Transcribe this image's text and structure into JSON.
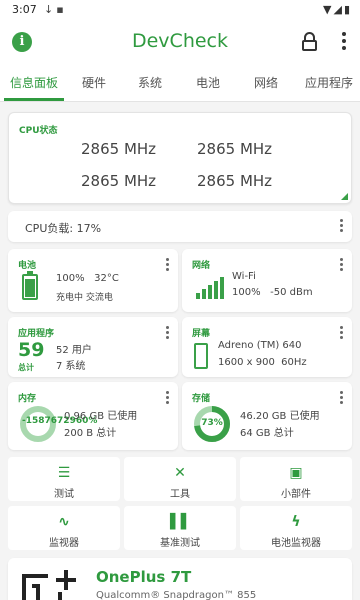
{
  "status_bar": {
    "time": "3:07",
    "icons_left": [
      "download-icon",
      "sim-icon"
    ],
    "icons_right": [
      "wifi-icon",
      "signal-icon",
      "battery-icon"
    ]
  },
  "app_bar": {
    "title": "DevCheck",
    "info_icon": "info-icon",
    "lock_icon": "lock-icon",
    "more_icon": "more-vert-icon"
  },
  "tabs": [
    {
      "label": "信息面板",
      "active": true
    },
    {
      "label": "硬件",
      "active": false
    },
    {
      "label": "系统",
      "active": false
    },
    {
      "label": "电池",
      "active": false
    },
    {
      "label": "网络",
      "active": false
    },
    {
      "label": "应用程序",
      "active": false
    }
  ],
  "cpu": {
    "title": "CPU状态",
    "freqs": [
      "2865 MHz",
      "2865 MHz",
      "2865 MHz",
      "2865 MHz"
    ]
  },
  "cpu_load": "CPU负载: 17%",
  "battery": {
    "title": "电池",
    "level": "100%",
    "temp": "32°C",
    "status": "充电中 交流电",
    "fill": 1.0
  },
  "network": {
    "title": "网络",
    "type": "Wi-Fi",
    "quality": "100%",
    "dbm": "-50 dBm",
    "signal_bars": 5
  },
  "apps": {
    "title": "应用程序",
    "total": "59",
    "total_label": "总计",
    "user": "52 用户",
    "system": "7 系统"
  },
  "screen": {
    "title": "屏幕",
    "gpu": "Adreno (TM) 640",
    "resolution": "1600 x 900",
    "refresh": "60Hz"
  },
  "memory": {
    "title": "内存",
    "percent_text": "-1587672960%",
    "used": "0.96 GB 已使用",
    "total": "200 B 总计"
  },
  "storage": {
    "title": "存储",
    "percent_text": "73%",
    "percent": 73,
    "used": "46.20 GB 已使用",
    "total": "64 GB 总计"
  },
  "tools": [
    {
      "label": "测试",
      "icon": "checklist-icon"
    },
    {
      "label": "工具",
      "icon": "tools-icon"
    },
    {
      "label": "小部件",
      "icon": "widgets-icon"
    },
    {
      "label": "监视器",
      "icon": "pulse-icon"
    },
    {
      "label": "基准测试",
      "icon": "bar-chart-icon"
    },
    {
      "label": "电池监视器",
      "icon": "bolt-icon"
    }
  ],
  "device": {
    "name": "OnePlus 7T",
    "soc": "Qualcomm® Snapdragon™ 855",
    "logo": "oneplus-logo"
  },
  "colors": {
    "accent": "#2f9a3f",
    "background": "#f4f4f4",
    "card": "#ffffff"
  }
}
